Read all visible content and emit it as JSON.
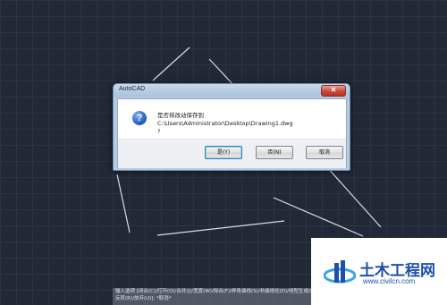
{
  "dialog": {
    "title": "AutoCAD",
    "close_glyph": "✕",
    "icon": "question-icon",
    "message_line1": "是否将改动保存到 C:\\Users\\Administrator\\Desktop\\Drawing1.dwg",
    "message_line2": "?",
    "buttons": {
      "yes": "是(Y)",
      "no": "否(N)",
      "cancel": "取消"
    }
  },
  "command_line": {
    "line1": "输入选项 [闭合(C)/打开(O)/合并(J)/宽度(W)/拟合(F)/样条曲线(S)/非曲线化(D)/线型生成(L)/",
    "line2": "反转(R)/放弃(U)]: *取消*"
  },
  "watermark": {
    "brand": "土木工程网",
    "url": "www.civilcn.com"
  },
  "colors": {
    "canvas_bg": "#222936",
    "brand_blue": "#1f4fa8"
  }
}
